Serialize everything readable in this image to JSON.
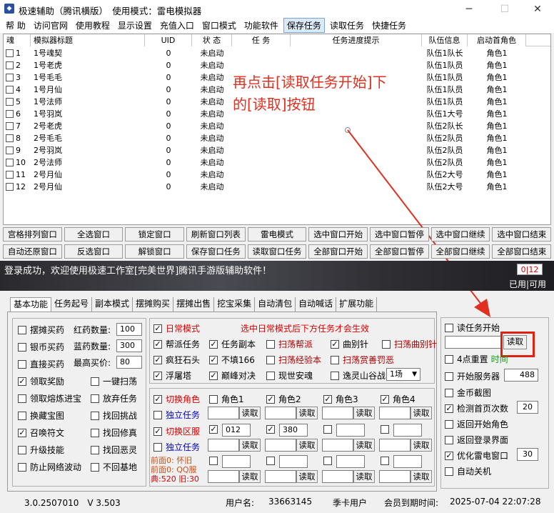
{
  "app": {
    "title": "极速辅助（腾讯横版）　使用模式：雷电模拟器"
  },
  "window_controls": {
    "minimize": "─",
    "maximize": "☐",
    "close": "✕"
  },
  "menu": [
    "帮 助",
    "访问官网",
    "使用教程",
    "显示设置",
    "充值入口",
    "窗口模式",
    "功能软件",
    "保存任务",
    "读取任务",
    "快捷任务"
  ],
  "table": {
    "headers": [
      "魂",
      "模拟器标题",
      "UID",
      "状 态",
      "任 务",
      "任务进度提示",
      "队伍信息",
      "启动首角色"
    ],
    "rows": [
      {
        "no": "1",
        "title": "1号魂契",
        "uid": "0",
        "status": "未启动",
        "team": "队伍1队长",
        "role": "角色1"
      },
      {
        "no": "2",
        "title": "1号老虎",
        "uid": "0",
        "status": "未启动",
        "team": "队伍1队员",
        "role": "角色1"
      },
      {
        "no": "3",
        "title": "1号毛毛",
        "uid": "0",
        "status": "未启动",
        "team": "队伍1队员",
        "role": "角色1"
      },
      {
        "no": "4",
        "title": "1号月仙",
        "uid": "0",
        "status": "未启动",
        "team": "队伍1队员",
        "role": "角色1"
      },
      {
        "no": "5",
        "title": "1号法师",
        "uid": "0",
        "status": "未启动",
        "team": "队伍1队员",
        "role": "角色1"
      },
      {
        "no": "6",
        "title": "1号羽岚",
        "uid": "0",
        "status": "未启动",
        "team": "队伍1大号",
        "role": "角色1"
      },
      {
        "no": "7",
        "title": "2号老虎",
        "uid": "0",
        "status": "未启动",
        "team": "队伍2队长",
        "role": "角色1"
      },
      {
        "no": "8",
        "title": "2号毛毛",
        "uid": "0",
        "status": "未启动",
        "team": "队伍2队员",
        "role": "角色1"
      },
      {
        "no": "9",
        "title": "2号羽岚",
        "uid": "0",
        "status": "未启动",
        "team": "队伍2队员",
        "role": "角色1"
      },
      {
        "no": "10",
        "title": "2号法师",
        "uid": "0",
        "status": "未启动",
        "team": "队伍2队员",
        "role": "角色1"
      },
      {
        "no": "11",
        "title": "2号月仙",
        "uid": "0",
        "status": "未启动",
        "team": "队伍2大号",
        "role": "角色1"
      },
      {
        "no": "12",
        "title": "2号月仙",
        "uid": "0",
        "status": "未启动",
        "team": "队伍2大号",
        "role": "角色1"
      }
    ]
  },
  "buttons_row1": [
    "宫格排列窗口",
    "全选窗口",
    "锁定窗口",
    "刷新窗口列表",
    "雷电模式",
    "选中窗口开始",
    "选中窗口暂停",
    "选中窗口继续",
    "选中窗口结束"
  ],
  "buttons_row2": [
    "自动还原窗口",
    "反选窗口",
    "解锁窗口",
    "保存窗口任务",
    "读取窗口任务",
    "全部窗口开始",
    "全部窗口暂停",
    "全部窗口继续",
    "全部窗口结束"
  ],
  "status": {
    "message": "登录成功，欢迎使用极速工作室[完美世界]腾讯手游版辅助软件！",
    "count": "0|12",
    "count_label": "已用|可用"
  },
  "tabs": [
    "基本功能",
    "任务起号",
    "副本模式",
    "摆摊购买",
    "摆摊出售",
    "挖宝采集",
    "自动清包",
    "自动喊话",
    "扩展功能"
  ],
  "left_col": {
    "c1": [
      "摆摊买药",
      "银币买药",
      "直接买药",
      "领取奖励",
      "领取熔炼进宝",
      "换藏宝图",
      "召唤符文",
      "升级技能",
      "防止网络波动"
    ],
    "c1_checked": [
      false,
      false,
      false,
      true,
      false,
      false,
      true,
      false,
      false
    ],
    "hp_label": "红药数量:",
    "hp_value": "100",
    "mp_label": "蓝药数量:",
    "mp_value": "300",
    "price_label": "最高买价:",
    "price_value": "80",
    "c2": [
      "一键扫荡",
      "放弃任务",
      "找回挑战",
      "找回修真",
      "找回恶灵",
      "不回基地"
    ]
  },
  "mid": {
    "daily_mode": "日常模式",
    "daily_hint": "选中日常模式后下方任务才会生效",
    "r1": [
      "帮派任务",
      "任务副本",
      "扫荡帮派",
      "曲别针",
      "扫荡曲别针"
    ],
    "r2": [
      "疯狂石头",
      "不填166",
      "扫荡经验本",
      "扫荡赏善罚恶"
    ],
    "r3": [
      "浮屠塔",
      "巅峰对决",
      "现世安魂",
      "逸灵山谷战"
    ],
    "battle_sel": "1场",
    "switch_role": "切换角色",
    "roles": [
      "角色1",
      "角色2",
      "角色3",
      "角色4"
    ],
    "roles_checked": [
      false,
      true,
      true,
      true
    ],
    "solo_task": "独立任务",
    "read": "读取",
    "switch_server": "切换区服",
    "server1": "012",
    "server2": "380",
    "solo_task2": "独立任务",
    "front_a": "前面0: 怀旧",
    "front_b": "前面0: QQ服",
    "front_c": "典:520 旧:30"
  },
  "right": {
    "read_task": "读任务开始",
    "read_btn": "读取",
    "reset4": "4点重置",
    "reset_time": "时间",
    "start_server": "开始服务器",
    "start_server_val": "488",
    "gold_capture": "金币截图",
    "detect_pages": "检测首页次数",
    "detect_val": "20",
    "return_start": "返回开始角色",
    "return_login": "返回登录界面",
    "opt_window": "优化雷电窗口",
    "opt_val": "30",
    "auto_shutdown": "自动关机"
  },
  "footer": {
    "version": "3.0.2507010　V 3.503",
    "user_label": "用户名:",
    "user": "33663145",
    "user_type": "季卡用户",
    "expire_label": "会员到期时间:",
    "expire": "2025-07-04 22:07:28"
  },
  "annotation": {
    "line1": "再点击[读取任务开始]下",
    "line2": "的[读取]按钮"
  },
  "colors": {
    "annotation": "#e03020",
    "highlight": "#e02010"
  }
}
